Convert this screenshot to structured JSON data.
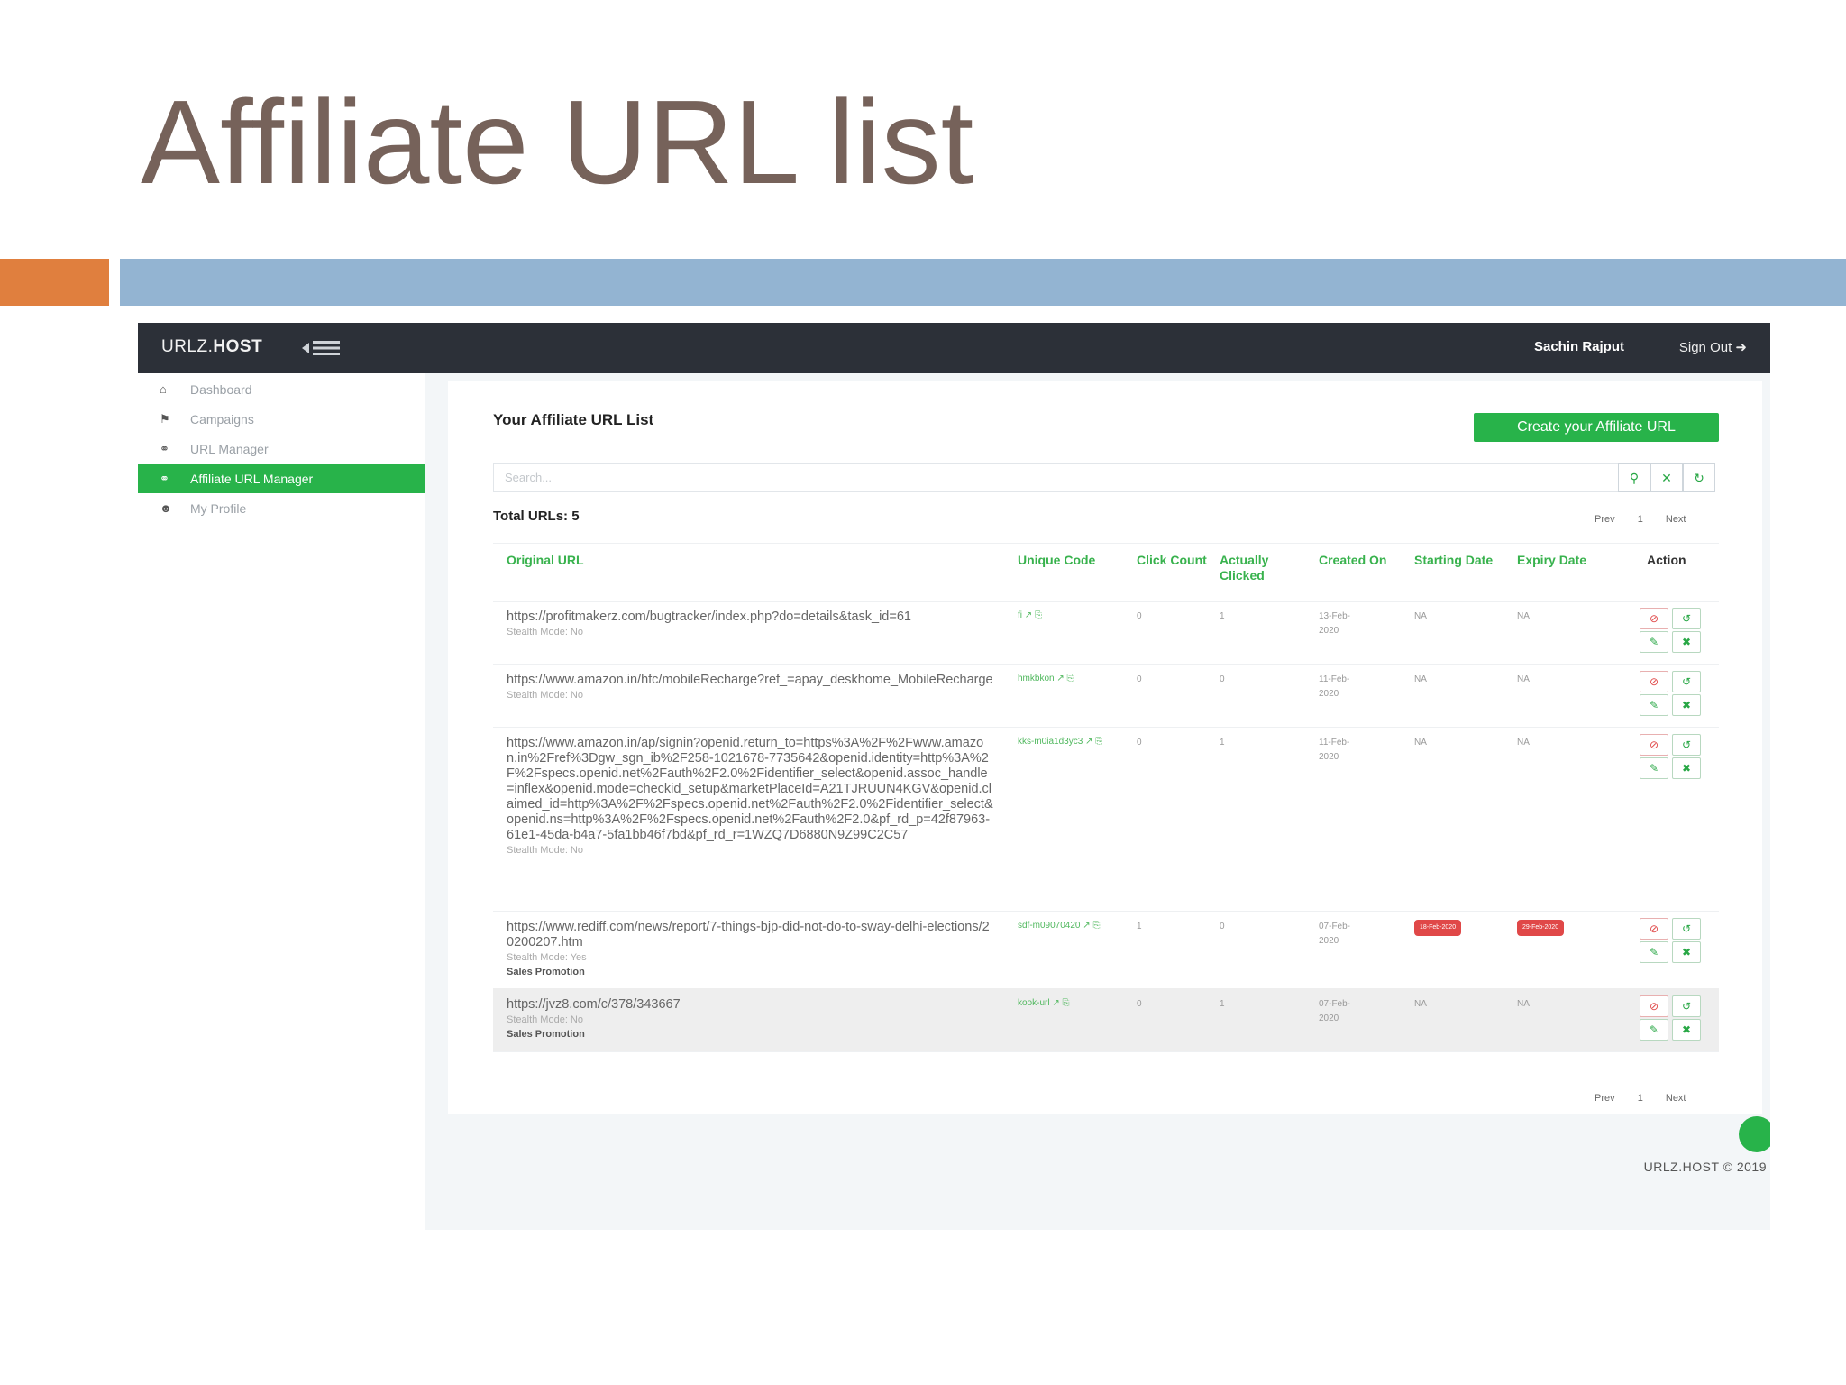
{
  "slide": {
    "title": "Affiliate URL list"
  },
  "app": {
    "brand_light": "URLZ.",
    "brand_bold": "HOST",
    "user_name": "Sachin Rajput",
    "signout_label": "Sign Out"
  },
  "sidebar": {
    "items": [
      {
        "label": "Dashboard",
        "icon": "home-icon"
      },
      {
        "label": "Campaigns",
        "icon": "flag-icon"
      },
      {
        "label": "URL Manager",
        "icon": "link-icon"
      },
      {
        "label": "Affiliate URL Manager",
        "icon": "link-icon",
        "active": true
      },
      {
        "label": "My Profile",
        "icon": "user-icon"
      }
    ]
  },
  "main": {
    "title": "Your Affiliate URL List",
    "create_button": "Create your Affiliate URL",
    "search_placeholder": "Search...",
    "total_label": "Total URLs: 5",
    "pager": {
      "prev": "Prev",
      "page": "1",
      "next": "Next"
    },
    "columns": [
      "Original URL",
      "Unique Code",
      "Click Count",
      "Actually Clicked",
      "Created On",
      "Starting Date",
      "Expiry Date",
      "Action"
    ],
    "rows": [
      {
        "url": "https://profitmakerz.com/bugtracker/index.php?do=details&task_id=61",
        "stealth": "Stealth Mode: No",
        "promo": "",
        "code": "fi",
        "clicks": "0",
        "actual": "1",
        "created": "13-Feb-2020",
        "start": "NA",
        "expiry": "NA"
      },
      {
        "url": "https://www.amazon.in/hfc/mobileRecharge?ref_=apay_deskhome_MobileRecharge",
        "stealth": "Stealth Mode: No",
        "promo": "",
        "code": "hmkbkon",
        "clicks": "0",
        "actual": "0",
        "created": "11-Feb-2020",
        "start": "NA",
        "expiry": "NA"
      },
      {
        "url": "https://www.amazon.in/ap/signin?openid.return_to=https%3A%2F%2Fwww.amazon.in%2Fref%3Dgw_sgn_ib%2F258-1021678-7735642&openid.identity=http%3A%2F%2Fspecs.openid.net%2Fauth%2F2.0%2Fidentifier_select&openid.assoc_handle=inflex&openid.mode=checkid_setup&marketPlaceId=A21TJRUUN4KGV&openid.claimed_id=http%3A%2F%2Fspecs.openid.net%2Fauth%2F2.0%2Fidentifier_select&openid.ns=http%3A%2F%2Fspecs.openid.net%2Fauth%2F2.0&pf_rd_p=42f87963-61e1-45da-b4a7-5fa1bb46f7bd&pf_rd_r=1WZQ7D6880N9Z99C2C57",
        "stealth": "Stealth Mode: No",
        "promo": "",
        "code": "kks-m0ia1d3yc3",
        "clicks": "0",
        "actual": "1",
        "created": "11-Feb-2020",
        "start": "NA",
        "expiry": "NA"
      },
      {
        "url": "https://www.rediff.com/news/report/7-things-bjp-did-not-do-to-sway-delhi-elections/20200207.htm",
        "stealth": "Stealth Mode: Yes",
        "promo": "Sales Promotion",
        "code": "sdf-m09070420",
        "clicks": "1",
        "actual": "0",
        "created": "07-Feb-2020",
        "start": "18-Feb-2020",
        "expiry": "29-Feb-2020",
        "start_badge": true,
        "expiry_badge": true
      },
      {
        "url": "https://jvz8.com/c/378/343667",
        "stealth": "Stealth Mode: No",
        "promo": "Sales Promotion",
        "code": "kook-url",
        "clicks": "0",
        "actual": "1",
        "created": "07-Feb-2020",
        "start": "NA",
        "expiry": "NA",
        "shaded": true
      }
    ]
  },
  "footer": {
    "text": "URLZ.HOST © 2019"
  },
  "colors": {
    "accent": "#28b34a",
    "topbar": "#2c3038",
    "danger": "#e04848",
    "title": "#76625a"
  }
}
